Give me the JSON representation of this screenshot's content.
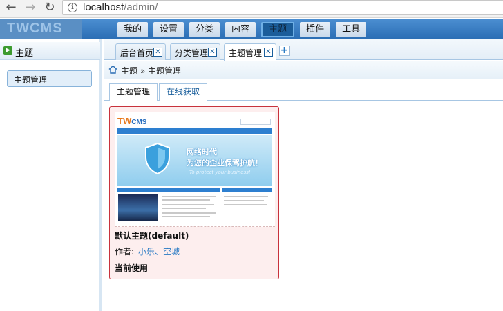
{
  "browser": {
    "url_host": "localhost",
    "url_path": "/admin/"
  },
  "app": {
    "logo": "TWCMS"
  },
  "topnav": [
    {
      "label": "我的"
    },
    {
      "label": "设置"
    },
    {
      "label": "分类"
    },
    {
      "label": "内容"
    },
    {
      "label": "主题",
      "active": true
    },
    {
      "label": "插件"
    },
    {
      "label": "工具"
    }
  ],
  "sidebar": {
    "title": "主题",
    "items": [
      {
        "label": "主题管理"
      }
    ]
  },
  "tabs": [
    {
      "label": "后台首页"
    },
    {
      "label": "分类管理"
    },
    {
      "label": "主题管理",
      "active": true
    }
  ],
  "breadcrumb": "主题 » 主题管理",
  "subtabs": [
    {
      "label": "主题管理",
      "active": true
    },
    {
      "label": "在线获取"
    }
  ],
  "theme": {
    "thumbnail": {
      "logo": "TW",
      "logo_suffix": "CMS",
      "slogan_line1": "网络时代",
      "slogan_line2": "为您的企业保驾护航！",
      "slogan_en": "To protect your business!"
    },
    "name": "默认主题(default)",
    "author_label": "作者:",
    "author": "小乐、空城",
    "status": "当前使用"
  },
  "colors": {
    "header_blue": "#2a6db4",
    "active_nav": "#1b5d9a",
    "card_border": "#c8323c",
    "card_bg": "#fdeeee",
    "link": "#2a7bc4"
  }
}
